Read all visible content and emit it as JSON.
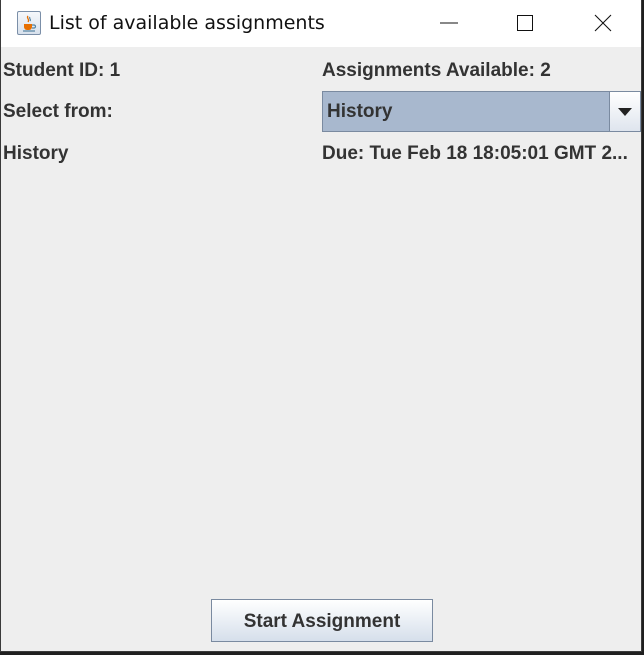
{
  "window": {
    "title": "List of available assignments",
    "icon": "java-cup-icon"
  },
  "titlebar_controls": {
    "minimize_icon": "minimize-icon",
    "maximize_icon": "maximize-icon",
    "close_icon": "close-icon"
  },
  "form": {
    "student_id_text": "Student ID: 1",
    "assignments_available_text": "Assignments Available: 2",
    "select_from_label": "Select from:",
    "combo_selected_value": "History",
    "combo_arrow_icon": "chevron-down-icon"
  },
  "assignment": {
    "name": "History",
    "due_text": "Due: Tue Feb 18 18:05:01 GMT 2..."
  },
  "actions": {
    "start_label": "Start Assignment"
  },
  "colors": {
    "window_bg": "#eeeeee",
    "combo_bg": "#a8b8ce",
    "text": "#333333"
  }
}
